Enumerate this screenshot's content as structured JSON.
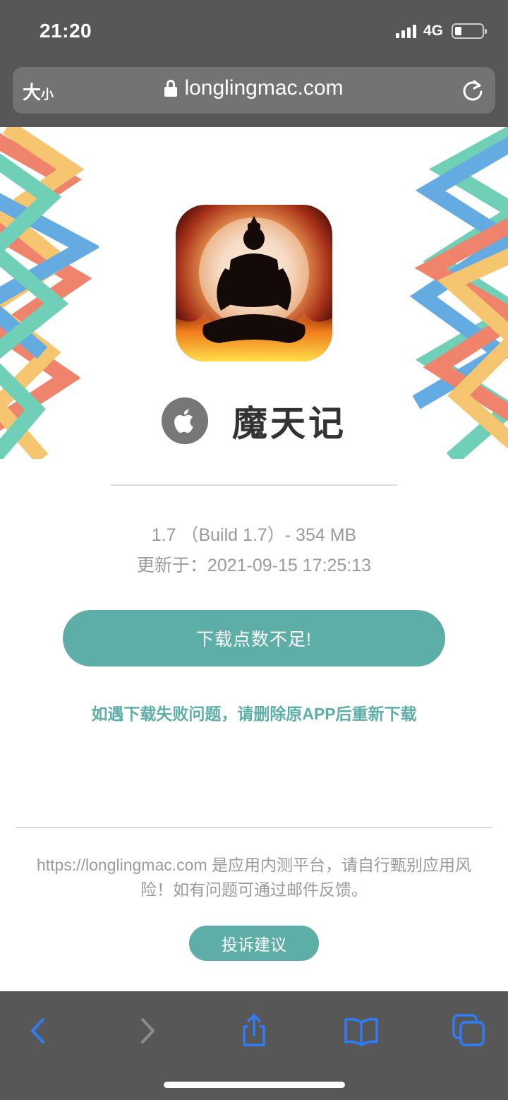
{
  "status_bar": {
    "time": "21:20",
    "network": "4G",
    "battery_level": 0.25
  },
  "url_bar": {
    "text_size_big": "大",
    "text_size_small": "小",
    "url": "longlingmac.com"
  },
  "app": {
    "name": "魔天记",
    "version_line": "1.7 （Build 1.7）- 354 MB",
    "updated_line": "更新于：2021-09-15 17:25:13"
  },
  "download_button": "下载点数不足!",
  "tip": "如遇下载失败问题，请删除原APP后重新下载",
  "footer": {
    "notice": "https://longlingmac.com 是应用内测平台，请自行甄别应用风险！如有问题可通过邮件反馈。",
    "complain_button": "投诉建议"
  },
  "toolbar": {
    "icons": [
      "back-icon",
      "forward-icon",
      "share-icon",
      "bookmarks-icon",
      "tabs-icon"
    ]
  },
  "colors": {
    "accent": "#5eaea8",
    "chrome": "#575757",
    "toolbar_active": "#2f7cf6",
    "toolbar_disabled": "#8c8c8c"
  }
}
